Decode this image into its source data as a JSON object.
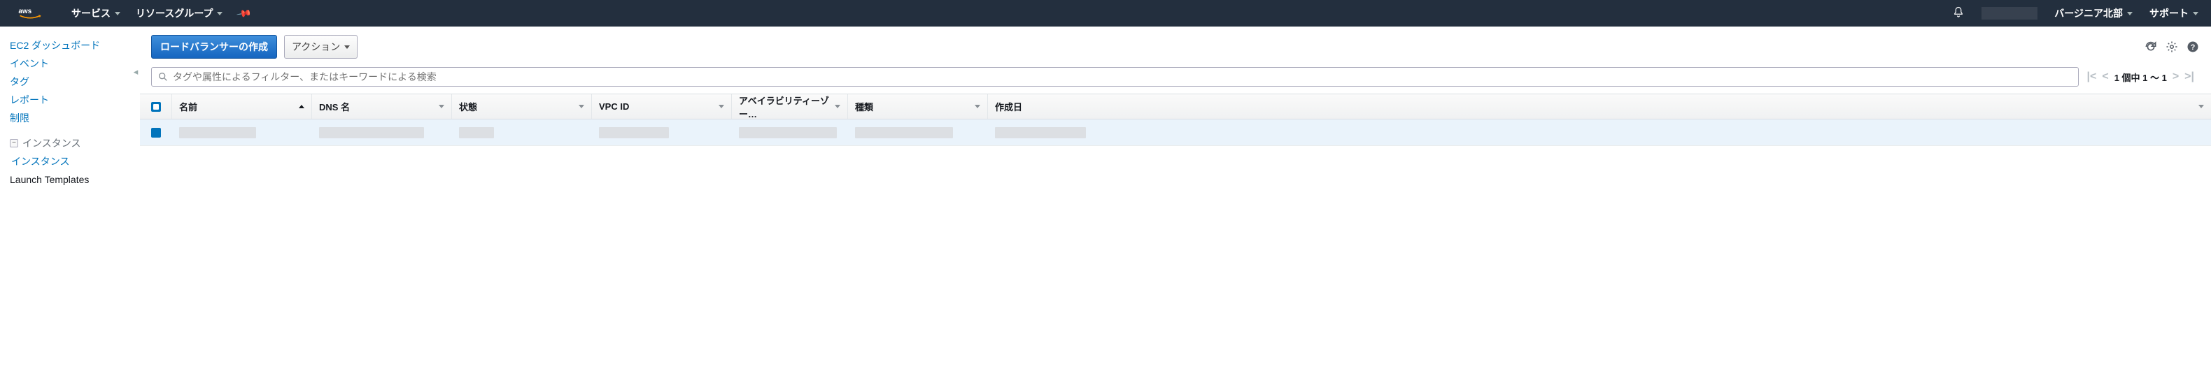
{
  "topnav": {
    "services": "サービス",
    "resource_groups": "リソースグループ",
    "region": "バージニア北部",
    "support": "サポート"
  },
  "sidebar": {
    "dashboard": "EC2 ダッシュボード",
    "events": "イベント",
    "tags": "タグ",
    "reports": "レポート",
    "limits": "制限",
    "group_instances": "インスタンス",
    "instances": "インスタンス",
    "launch_templates": "Launch Templates"
  },
  "toolbar": {
    "create_lb": "ロードバランサーの作成",
    "actions": "アクション"
  },
  "search": {
    "placeholder": "タグや属性によるフィルター、またはキーワードによる検索"
  },
  "pager": {
    "text": "1 個中 1 ～ 1"
  },
  "columns": {
    "name": "名前",
    "dns": "DNS 名",
    "state": "状態",
    "vpc": "VPC ID",
    "az": "アベイラビリティーゾー…",
    "type": "種類",
    "created": "作成日"
  }
}
